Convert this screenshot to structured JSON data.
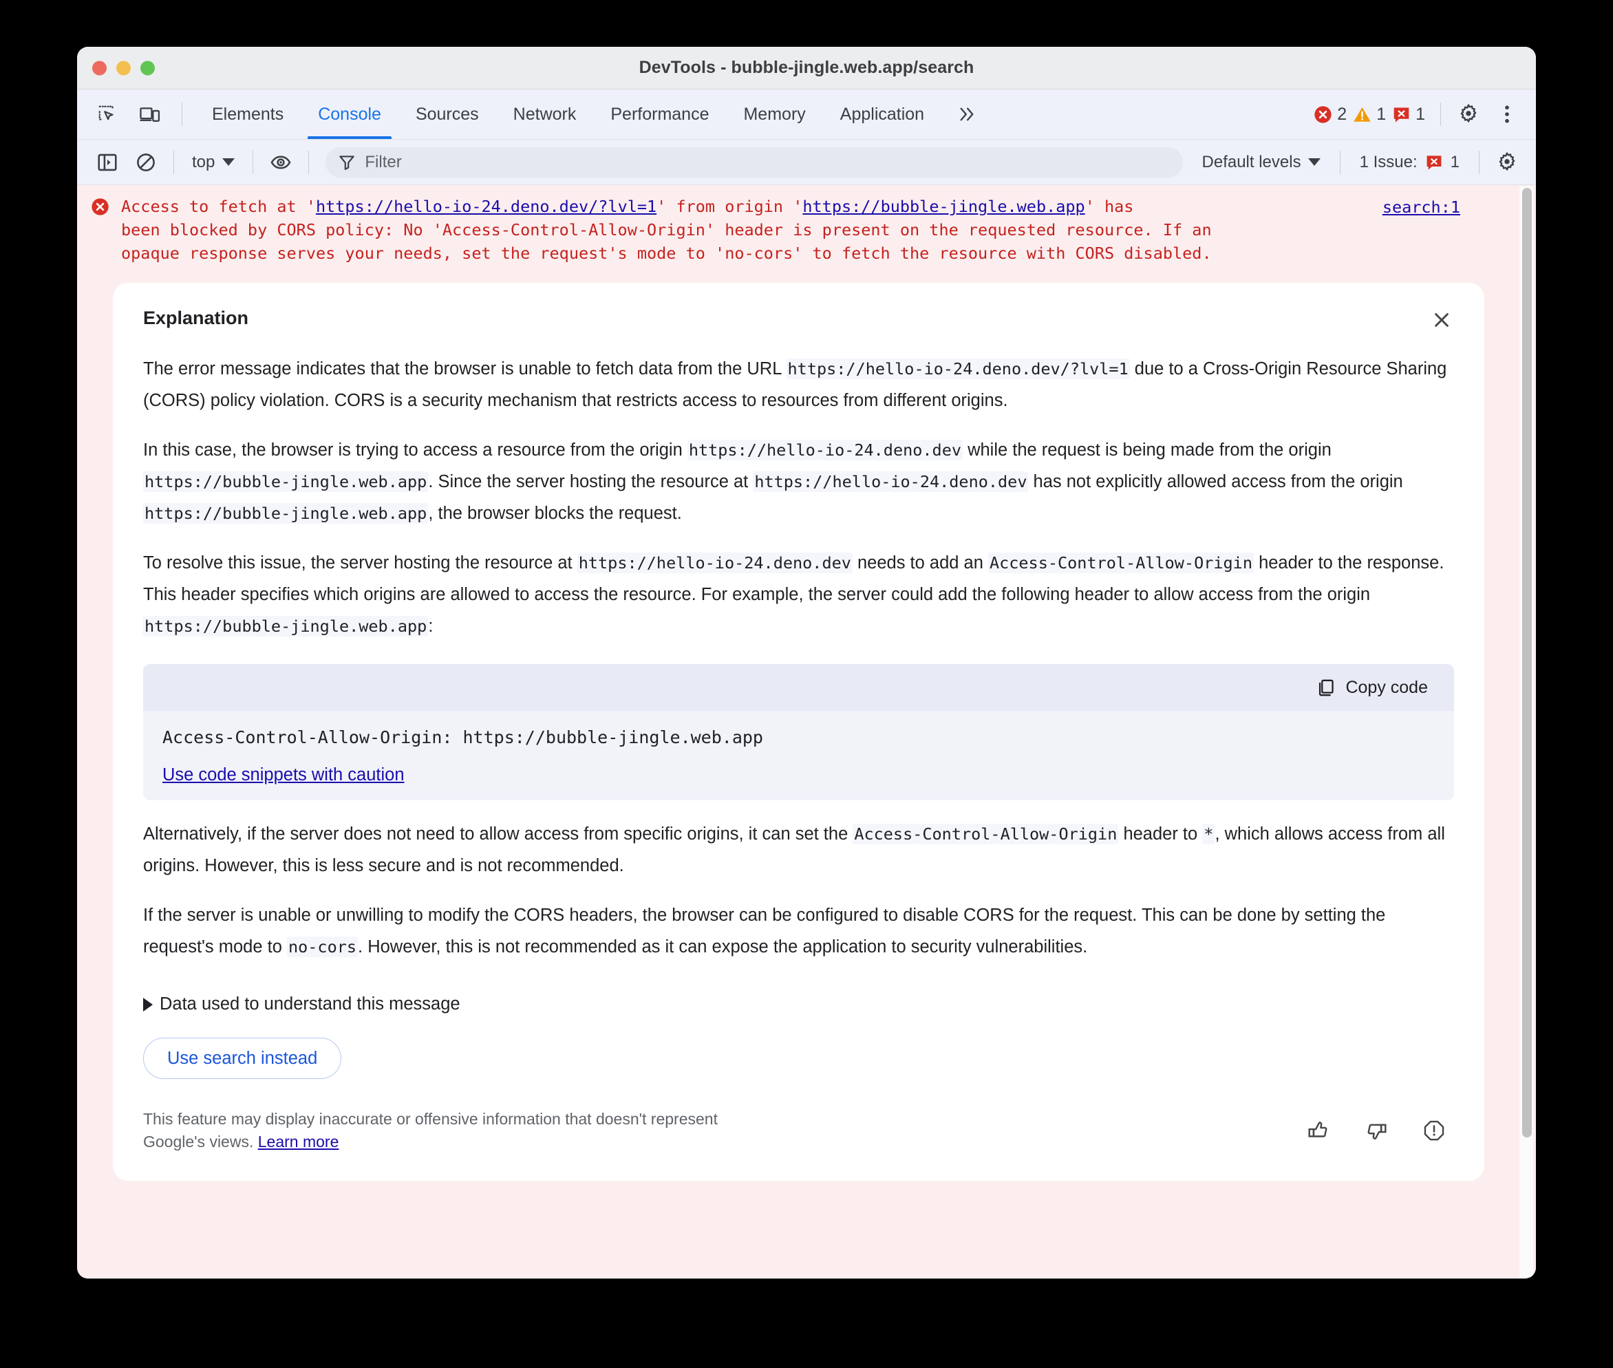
{
  "window": {
    "title": "DevTools - bubble-jingle.web.app/search",
    "traffic_lights": [
      "close-red",
      "minimize-yellow",
      "maximize-green"
    ]
  },
  "tabbar": {
    "left_icons": [
      {
        "name": "inspect-element-icon",
        "label": "Inspect element"
      },
      {
        "name": "device-toolbar-icon",
        "label": "Toggle device toolbar"
      }
    ],
    "tabs": [
      {
        "label": "Elements",
        "active": false
      },
      {
        "label": "Console",
        "active": true
      },
      {
        "label": "Sources",
        "active": false
      },
      {
        "label": "Network",
        "active": false
      },
      {
        "label": "Performance",
        "active": false
      },
      {
        "label": "Memory",
        "active": false
      },
      {
        "label": "Application",
        "active": false
      }
    ],
    "more_tabs_label": "≫",
    "counts": {
      "errors": "2",
      "warnings": "1",
      "issues": "1"
    },
    "settings_label": "Settings",
    "more_label": "More options"
  },
  "filterbar": {
    "sidebar_toggle": "console-sidebar-icon",
    "clear_console": "clear-console-icon",
    "context": "top",
    "eye_icon": "live-expression-icon",
    "filter_placeholder": "Filter",
    "levels": "Default levels",
    "issues_label": "1 Issue:",
    "issues_count": "1",
    "settings": "console-settings-icon"
  },
  "console": {
    "error": {
      "line1_prefix": "Access to fetch at '",
      "link1": "https://hello-io-24.deno.dev/?lvl=1",
      "line1_mid": "' from origin '",
      "link2": "https://bubble-jingle.web.app",
      "line1_suffix": "' has",
      "body": "been blocked by CORS policy: No 'Access-Control-Allow-Origin' header is present on the requested resource. If an\nopaque response serves your needs, set the request's mode to 'no-cors' to fetch the resource with CORS disabled.",
      "source_link": "search:1"
    }
  },
  "explanation": {
    "title": "Explanation",
    "close_label": "Close",
    "paragraphs": [
      {
        "parts": [
          {
            "t": "text",
            "v": "The error message indicates that the browser is unable to fetch data from the URL "
          },
          {
            "t": "code",
            "v": "https://hello-io-24.deno.dev/?lvl=1"
          },
          {
            "t": "text",
            "v": " due to a Cross-Origin Resource Sharing (CORS) policy violation. CORS is a security mechanism that restricts access to resources from different origins."
          }
        ]
      },
      {
        "parts": [
          {
            "t": "text",
            "v": "In this case, the browser is trying to access a resource from the origin "
          },
          {
            "t": "code",
            "v": "https://hello-io-24.deno.dev"
          },
          {
            "t": "text",
            "v": " while the request is being made from the origin "
          },
          {
            "t": "code",
            "v": "https://bubble-jingle.web.app"
          },
          {
            "t": "text",
            "v": ". Since the server hosting the resource at "
          },
          {
            "t": "code",
            "v": "https://hello-io-24.deno.dev"
          },
          {
            "t": "text",
            "v": " has not explicitly allowed access from the origin "
          },
          {
            "t": "code",
            "v": "https://bubble-jingle.web.app"
          },
          {
            "t": "text",
            "v": ", the browser blocks the request."
          }
        ]
      },
      {
        "parts": [
          {
            "t": "text",
            "v": "To resolve this issue, the server hosting the resource at "
          },
          {
            "t": "code",
            "v": "https://hello-io-24.deno.dev"
          },
          {
            "t": "text",
            "v": " needs to add an "
          },
          {
            "t": "code",
            "v": "Access-Control-Allow-Origin"
          },
          {
            "t": "text",
            "v": " header to the response. This header specifies which origins are allowed to access the resource. For example, the server could add the following header to allow access from the origin "
          },
          {
            "t": "code",
            "v": "https://bubble-jingle.web.app"
          },
          {
            "t": "text",
            "v": ":"
          }
        ]
      }
    ],
    "codeblock": {
      "copy_label": "Copy code",
      "copy_icon": "copy-icon",
      "code": "Access-Control-Allow-Origin: https://bubble-jingle.web.app",
      "caution_link": "Use code snippets with caution"
    },
    "paragraphs_after": [
      {
        "parts": [
          {
            "t": "text",
            "v": "Alternatively, if the server does not need to allow access from specific origins, it can set the "
          },
          {
            "t": "code",
            "v": "Access-Control-Allow-Origin"
          },
          {
            "t": "text",
            "v": " header to "
          },
          {
            "t": "code",
            "v": "*"
          },
          {
            "t": "text",
            "v": ", which allows access from all origins. However, this is less secure and is not recommended."
          }
        ]
      },
      {
        "parts": [
          {
            "t": "text",
            "v": "If the server is unable or unwilling to modify the CORS headers, the browser can be configured to disable CORS for the request. This can be done by setting the request's mode to "
          },
          {
            "t": "code",
            "v": "no-cors"
          },
          {
            "t": "text",
            "v": ". However, this is not recommended as it can expose the application to security vulnerabilities."
          }
        ]
      }
    ],
    "disclosure_label": "Data used to understand this message",
    "search_button": "Use search instead",
    "disclaimer_text": "This feature may display inaccurate or offensive information that doesn't represent Google's views. ",
    "disclaimer_link": "Learn more",
    "feedback": [
      {
        "name": "thumb-up-icon",
        "label": "Good response"
      },
      {
        "name": "thumb-down-icon",
        "label": "Bad response"
      },
      {
        "name": "report-icon",
        "label": "Report"
      }
    ]
  },
  "colors": {
    "accent": "#1a73e8",
    "error_bg": "#fceeee",
    "error_text": "#c5221f",
    "link": "#1a0dab",
    "toolbar_bg": "#eef1fa",
    "titlebar_bg": "#ecedee"
  }
}
